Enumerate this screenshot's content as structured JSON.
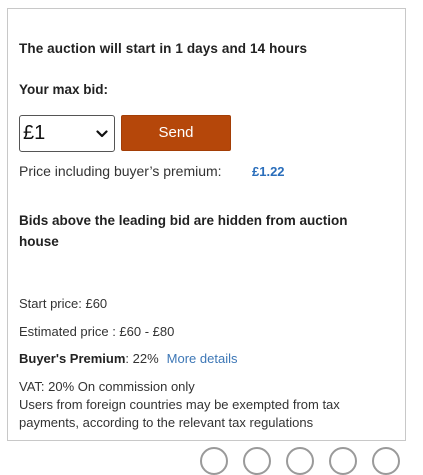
{
  "auction": {
    "start_notice": "The auction will start in 1 days and 14 hours",
    "max_bid_label": "Your max bid:",
    "selected_bid": "£1",
    "send_label": "Send",
    "premium_label": "Price including buyer’s premium:",
    "premium_value": "£1.22",
    "hidden_notice": "Bids above the leading bid are hidden from auction house"
  },
  "details": {
    "start_price": "Start price: £60",
    "estimated_price": "Estimated price : £60 - £80",
    "buyers_premium_label": "Buyer's Premium",
    "buyers_premium_value": ": 22%",
    "more_details_link": "More details",
    "vat_line": "VAT: 20% On commission only",
    "foreign_note": "Users from foreign countries may be exempted from tax payments, according to the relevant tax regulations"
  },
  "colors": {
    "send_button": "#b5470a",
    "price_accent": "#2a6ebb",
    "link": "#3d77b6"
  },
  "icons": {
    "select_arrow": "chevron-down-icon"
  }
}
